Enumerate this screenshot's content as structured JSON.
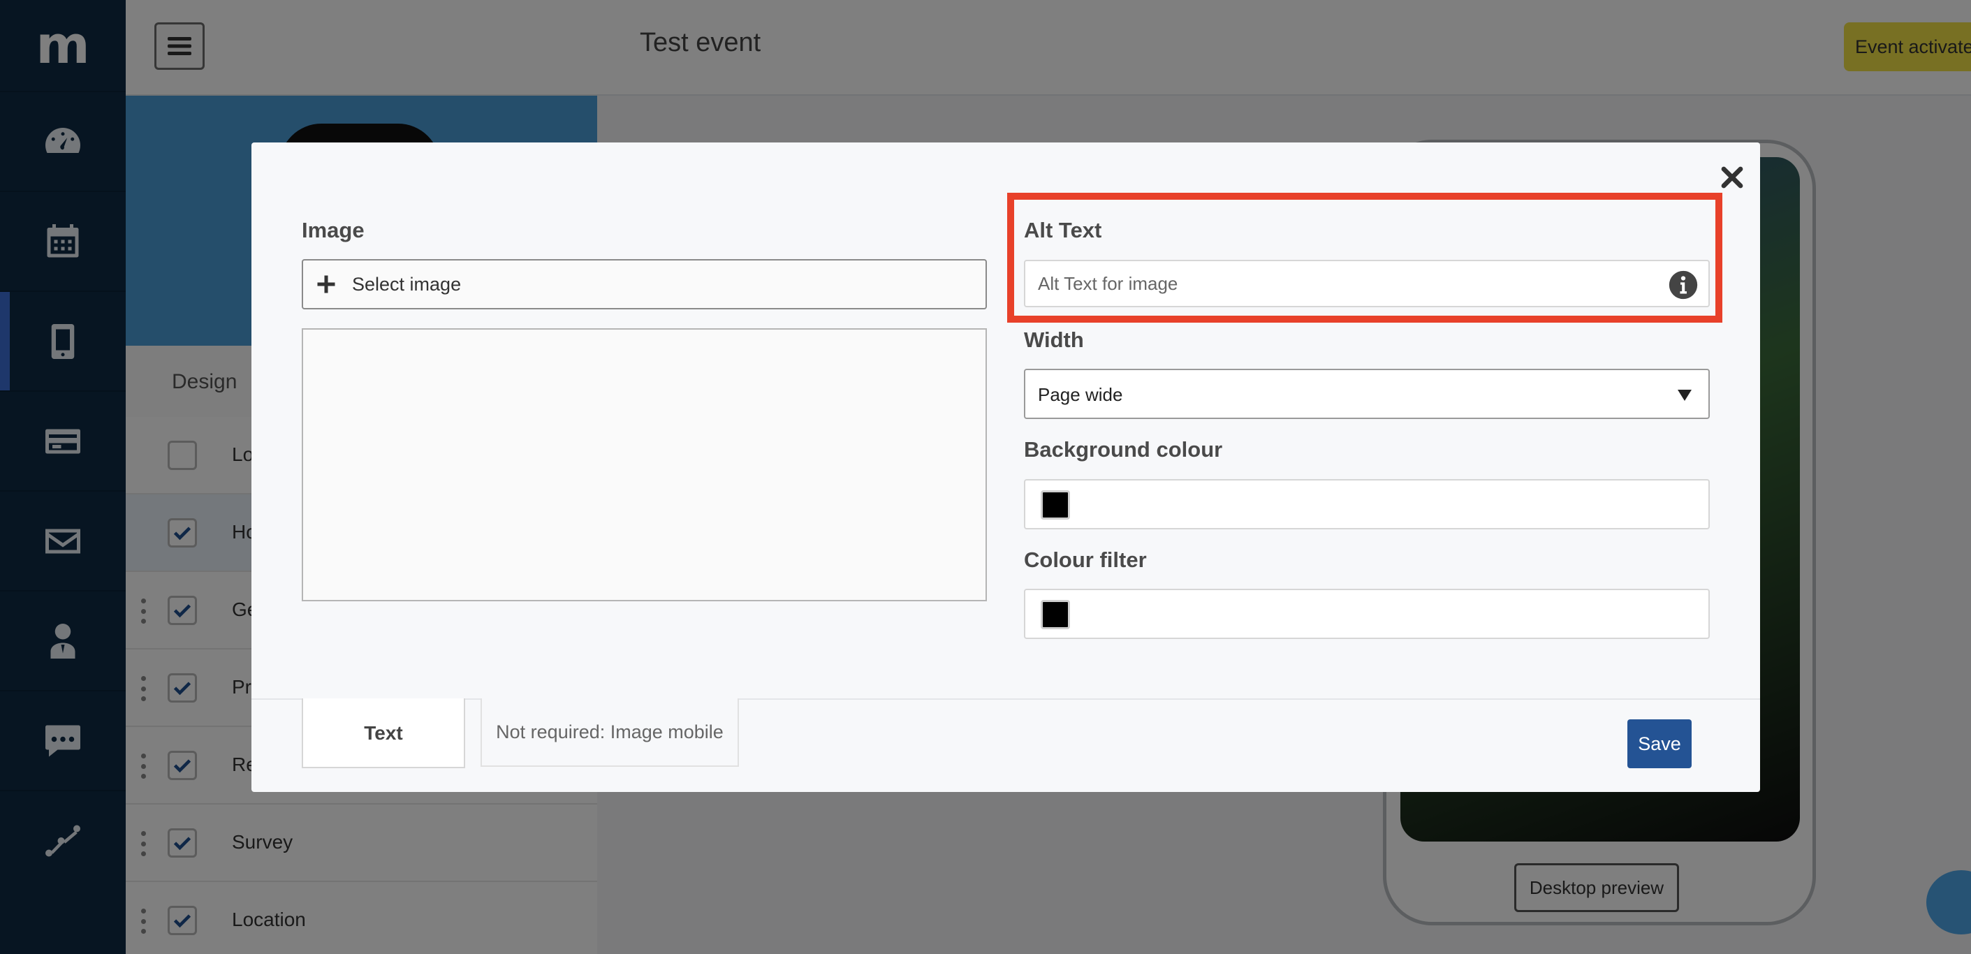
{
  "app": {
    "logo_letter": "m",
    "event_title": "Test event",
    "event_status": "Event activated"
  },
  "sidebar": {
    "items": [
      {
        "icon": "dashboard-icon"
      },
      {
        "icon": "calendar-icon"
      },
      {
        "icon": "mobile-icon",
        "active": true
      },
      {
        "icon": "credit-card-icon"
      },
      {
        "icon": "mail-icon"
      },
      {
        "icon": "user-icon"
      },
      {
        "icon": "chat-icon"
      },
      {
        "icon": "analytics-icon"
      }
    ]
  },
  "left_panel": {
    "design_tab": "Design",
    "rows": [
      {
        "label": "Lo",
        "checked": false
      },
      {
        "label": "Ho",
        "checked": true
      },
      {
        "label": "Ge",
        "checked": true
      },
      {
        "label": "Pr",
        "checked": true
      },
      {
        "label": "Re",
        "checked": true
      },
      {
        "label": "Survey",
        "checked": true
      },
      {
        "label": "Location",
        "checked": true
      }
    ]
  },
  "preview": {
    "desktop_preview_label": "Desktop preview"
  },
  "modal": {
    "image_label": "Image",
    "select_image_label": "Select image",
    "alt_text_label": "Alt Text",
    "alt_text_placeholder": "Alt Text for image",
    "alt_text_value": "",
    "width_label": "Width",
    "width_value": "Page wide",
    "background_colour_label": "Background colour",
    "background_colour_value": "#000000",
    "colour_filter_label": "Colour filter",
    "colour_filter_value": "#000000",
    "tabs": [
      {
        "label": "Text",
        "active": true
      },
      {
        "label": "Not required: Image mobile",
        "active": false
      }
    ],
    "save_label": "Save"
  },
  "colors": {
    "sidebar_bg": "#0f2a44",
    "highlight": "#e8412a",
    "save_button": "#245394",
    "event_activated_bg": "#f0e046"
  }
}
